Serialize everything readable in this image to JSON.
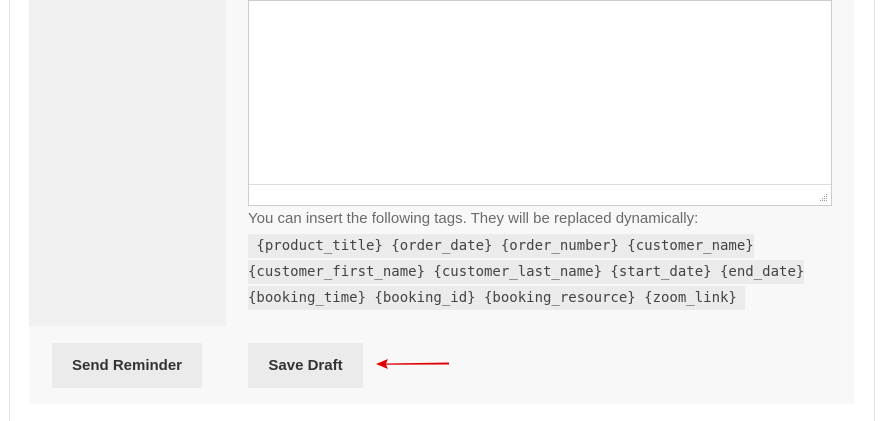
{
  "editor": {
    "help_text": "You can insert the following tags. They will be replaced dynamically:",
    "tag_lines": [
      " {product_title} {order_date} {order_number} {customer_name}",
      "{customer_first_name} {customer_last_name} {start_date} {end_date}",
      "{booking_time} {booking_id} {booking_resource} {zoom_link} "
    ]
  },
  "actions": {
    "send_reminder_label": "Send Reminder",
    "save_draft_label": "Save Draft"
  },
  "colors": {
    "annotation_arrow": "#dd0000",
    "button_bg": "#ebebeb",
    "tag_bg": "#ebebeb"
  },
  "icons": {
    "arrow": "annotation-arrow-icon",
    "resize": "resize-handle-icon"
  }
}
